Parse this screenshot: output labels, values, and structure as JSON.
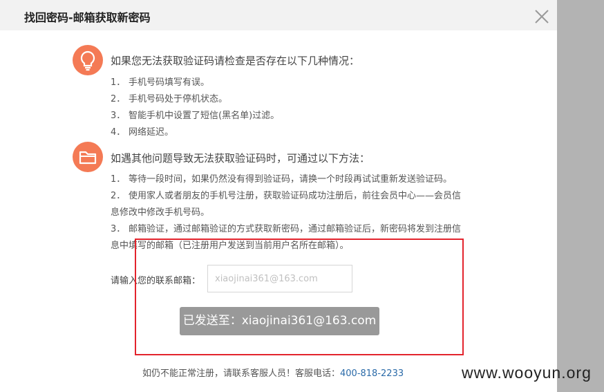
{
  "dialog": {
    "title": "找回密码-邮箱获取新密码",
    "close_icon": "close-icon"
  },
  "section1": {
    "icon": "lightbulb-icon",
    "heading": "如果您无法获取验证码请检查是否存在以下几种情况：",
    "items": [
      {
        "num": "1．",
        "text": "手机号码填写有误。"
      },
      {
        "num": "2．",
        "text": "手机号码处于停机状态。"
      },
      {
        "num": "3．",
        "text": "智能手机中设置了短信(黑名单)过滤。"
      },
      {
        "num": "4．",
        "text": "网络延迟。"
      }
    ]
  },
  "section2": {
    "icon": "folder-icon",
    "heading": "如遇其他问题导致无法获取验证码时，可通过以下方法：",
    "items": [
      {
        "num": "1．",
        "line1": "等待一段时间，如果仍然没有得到验证码，请换一个时段再试试重新发送验证码。",
        "line2": ""
      },
      {
        "num": "2．",
        "line1": "使用家人或者朋友的手机号注册，获取验证码成功注册后，前往会员中心——会员信",
        "line2": "息修改中修改手机号码。"
      },
      {
        "num": "3．",
        "line1": "邮箱验证，通过邮箱验证的方式获取新密码，通过邮箱验证后，新密码将发到注册信",
        "line2": "息中填写的邮箱（已注册用户发送到当前用户名所在邮箱）。"
      }
    ]
  },
  "email_form": {
    "label": "请输入您的联系邮箱：",
    "placeholder": "xiaojinai361@163.com"
  },
  "toast": {
    "text": "已发送至：xiaojinai361@163.com"
  },
  "footer": {
    "text": "如仍不能正常注册，请联系客服人员！客服电话：",
    "phone": "400-818-2233"
  },
  "watermark": {
    "text": "www.wooyun.org"
  },
  "colors": {
    "icon_bg": "#f47a55",
    "highlight_border": "#e3232c",
    "toast_bg": "#999999",
    "phone_link": "#2a6aa8"
  }
}
